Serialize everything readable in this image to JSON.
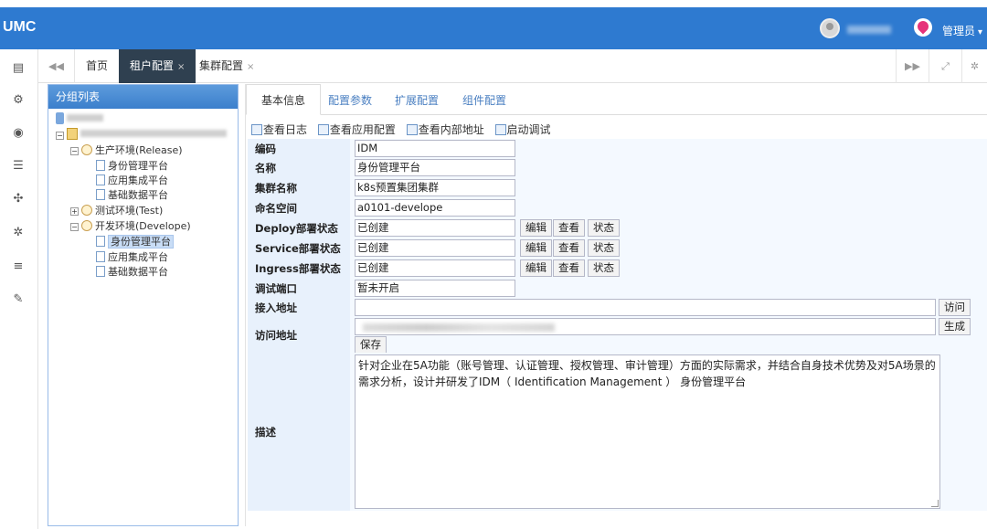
{
  "app": {
    "brand": "UMC",
    "admin_label": "管理员"
  },
  "tabs": {
    "home": "首页",
    "tenant": "租户配置",
    "cluster": "集群配置",
    "close": "×"
  },
  "group_panel": {
    "title": "分组列表",
    "tree": {
      "prod_env": "生产环境(Release)",
      "prod_items": [
        "身份管理平台",
        "应用集成平台",
        "基础数据平台"
      ],
      "test_env": "测试环境(Test)",
      "dev_env": "开发环境(Develope)",
      "dev_items": [
        "身份管理平台",
        "应用集成平台",
        "基础数据平台"
      ]
    }
  },
  "subtabs": [
    "基本信息",
    "配置参数",
    "扩展配置",
    "组件配置"
  ],
  "toolbar": [
    "查看日志",
    "查看应用配置",
    "查看内部地址",
    "启动调试"
  ],
  "form": {
    "code_label": "编码",
    "code_value": "IDM",
    "name_label": "名称",
    "name_value": "身份管理平台",
    "cluster_label": "集群名称",
    "cluster_value": "k8s预置集团集群",
    "ns_label": "命名空间",
    "ns_value": "a0101-develope",
    "deploy_label": "Deploy部署状态",
    "deploy_value": "已创建",
    "service_label": "Service部署状态",
    "service_value": "已创建",
    "ingress_label": "Ingress部署状态",
    "ingress_value": "已创建",
    "btn_edit": "编辑",
    "btn_view": "查看",
    "btn_status": "状态",
    "debug_label": "调试端口",
    "debug_value": "暂未开启",
    "access_in_label": "接入地址",
    "access_in_value": "",
    "btn_visit": "访问",
    "access_url_label": "访问地址",
    "btn_generate": "生成",
    "btn_save": "保存",
    "desc_label": "描述",
    "desc_value": "针对企业在5A功能（账号管理、认证管理、授权管理、审计管理）方面的实际需求，并结合自身技术优势及对5A场景的需求分析，设计并研发了IDM（ Identification Management ） 身份管理平台"
  }
}
